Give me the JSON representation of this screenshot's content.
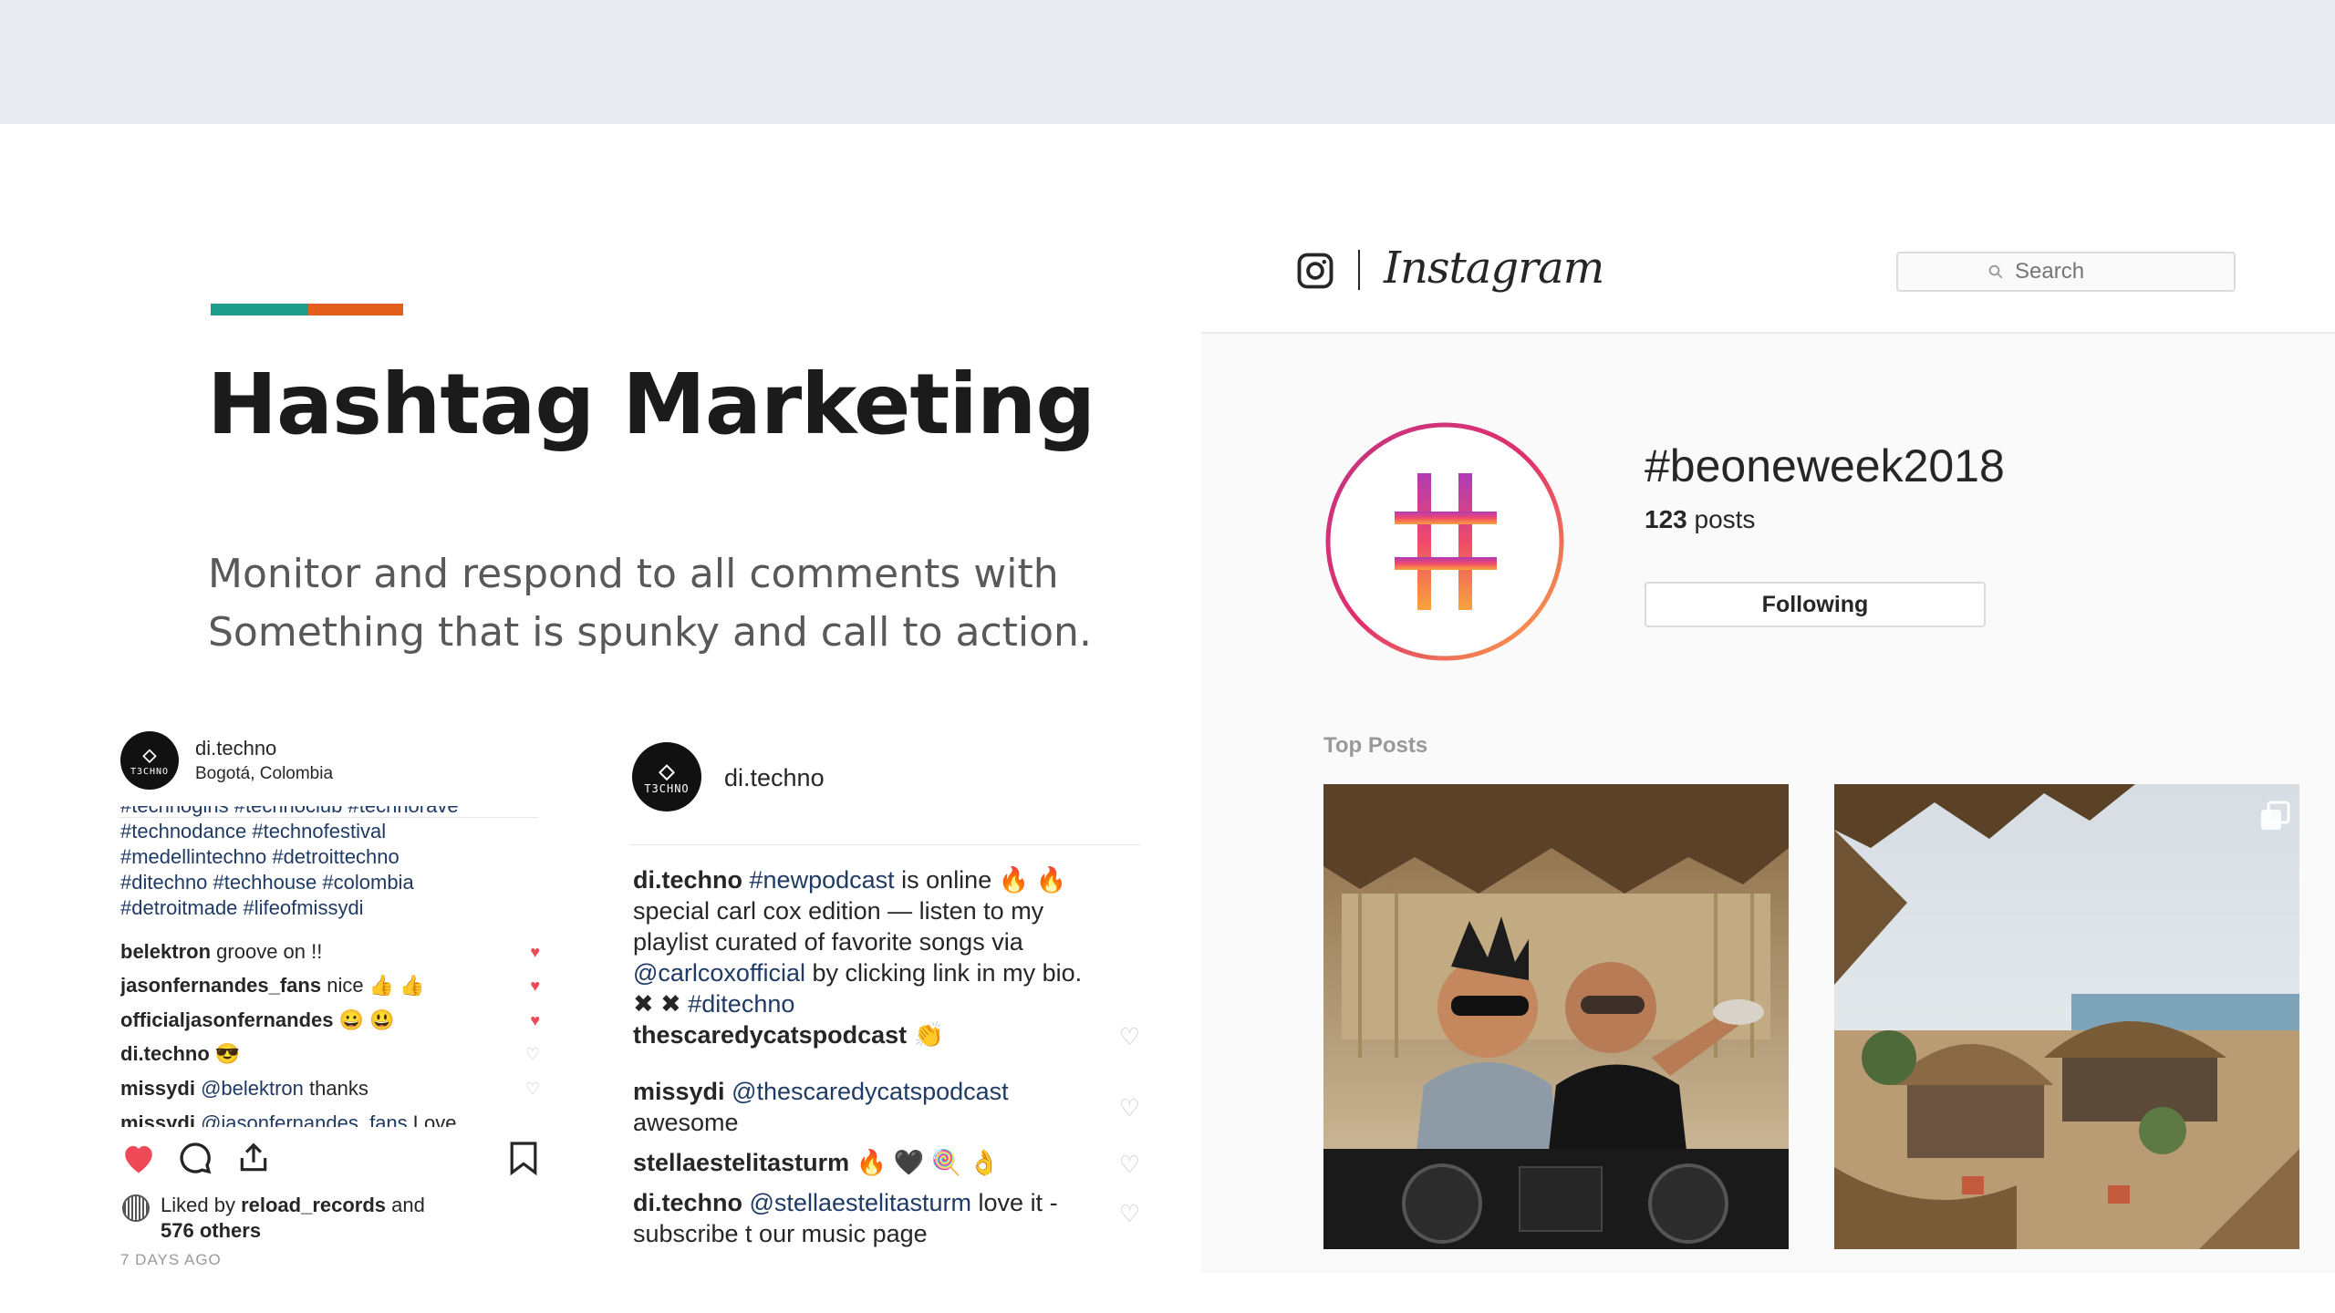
{
  "slide": {
    "title": "Hashtag Marketing",
    "subtitle_line1": "Monitor and respond to all comments with",
    "subtitle_line2": "Something that is spunky and call to action.",
    "accent_colors": [
      "#1e9e8a",
      "#e45e1c"
    ]
  },
  "post1": {
    "username": "di.techno",
    "location": "Bogotá, Colombia",
    "avatar_label": "T3CHNO",
    "hashtag_lines": [
      "#technogirls #technoclub #technorave",
      "#technodance #technofestival",
      "#medellintechno #detroittechno",
      "#ditechno #techhouse #colombia",
      "#detroitmade #lifeofmissydi"
    ],
    "comments": [
      {
        "user": "belektron",
        "text": "groove on !!",
        "liked": true
      },
      {
        "user": "jasonfernandes_fans",
        "text": "nice 👍 👍",
        "liked": true
      },
      {
        "user": "officialjasonfernandes",
        "text": "😀 😃",
        "liked": true
      },
      {
        "user": "di.techno",
        "text": "😎",
        "liked": false
      },
      {
        "user": "missydi",
        "mention": "@belektron",
        "text": "thanks",
        "liked": false
      },
      {
        "user": "missydi",
        "mention": "@jasonfernandes_fans",
        "text": "Love",
        "liked": false
      }
    ],
    "liked_by_prefix": "Liked by",
    "liked_by_user": "reload_records",
    "liked_by_suffix": "and",
    "liked_others": "576 others",
    "time": "7 DAYS AGO"
  },
  "post2": {
    "username": "di.techno",
    "avatar_label": "T3CHNO",
    "caption": {
      "user": "di.techno",
      "tag": "#newpodcast",
      "text1": "is online 🔥 🔥",
      "line2": "special carl cox edition — listen to my",
      "line3": "playlist curated of favorite songs via",
      "mention": "@carlcoxofficial",
      "text3": "by clicking link in my bio.",
      "marks": "✖ ✖",
      "tag2": "#ditechno"
    },
    "comments": [
      {
        "user": "thescaredycatspodcast",
        "mention": "",
        "text": "👏"
      },
      {
        "user": "missydi",
        "mention": "@thescaredycatspodcast",
        "text": "awesome"
      },
      {
        "user": "stellaestelitasturm",
        "mention": "",
        "text": "🔥 🖤 🍭 👌"
      },
      {
        "user": "di.techno",
        "mention": "@stellaestelitasturm",
        "text": "love it - subscribe t our music page"
      }
    ]
  },
  "instagram": {
    "wordmark": "Instagram",
    "search_placeholder": "Search",
    "hashtag": "#beoneweek2018",
    "post_count": "123",
    "post_count_label": "posts",
    "follow_label": "Following",
    "top_posts_label": "Top Posts",
    "icons": [
      "instagram-camera-icon",
      "search-icon",
      "hashtag-icon",
      "multiple-posts-icon"
    ]
  }
}
